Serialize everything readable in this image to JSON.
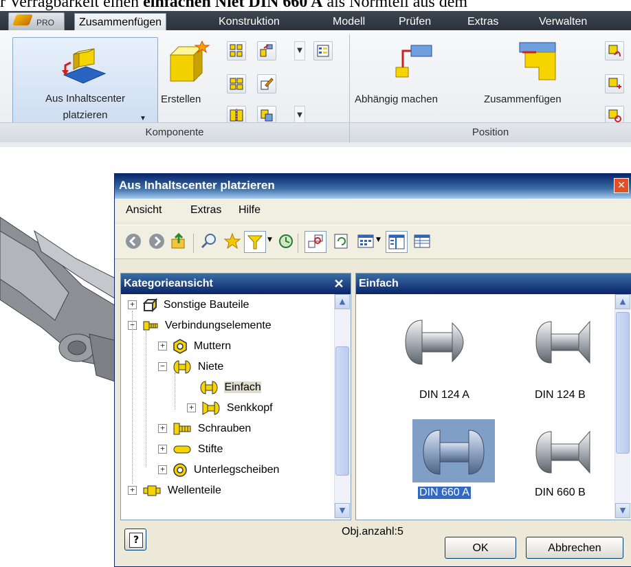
{
  "doc": {
    "text_before": "r Verragbarkeit einen ",
    "text_bold": "einfachen Niet DIN 660 A",
    "text_after": " als Normteil aus dem"
  },
  "ribbon": {
    "app_button_label": "PRO",
    "tabs": [
      "Zusammenfügen",
      "Konstruktion",
      "Modell",
      "Prüfen",
      "Extras",
      "Verwalten"
    ],
    "active_tab": "Zusammenfügen",
    "groups": {
      "komponente": {
        "label": "Komponente",
        "place_button_line1": "Aus Inhaltscenter",
        "place_button_line2": "platzieren",
        "create_button": "Erstellen"
      },
      "position": {
        "label": "Position",
        "constrain_button": "Abhängig machen",
        "assemble_button": "Zusammenfügen"
      }
    }
  },
  "dialog": {
    "title": "Aus Inhaltscenter platzieren",
    "close_glyph": "✕",
    "menu": [
      "Ansicht",
      "Extras",
      "Hilfe"
    ],
    "left_panel": {
      "title": "Kategorieansicht",
      "close_glyph": "✕",
      "tree": [
        {
          "label": "Sonstige Bauteile",
          "expander": "+"
        },
        {
          "label": "Verbindungselemente",
          "expander": "−"
        },
        {
          "label": "Muttern",
          "expander": "+"
        },
        {
          "label": "Niete",
          "expander": "−"
        },
        {
          "label": "Einfach",
          "expander": ""
        },
        {
          "label": "Senkkopf",
          "expander": "+"
        },
        {
          "label": "Schrauben",
          "expander": "+"
        },
        {
          "label": "Stifte",
          "expander": "+"
        },
        {
          "label": "Unterlegscheiben",
          "expander": "+"
        },
        {
          "label": "Wellenteile",
          "expander": "+"
        }
      ]
    },
    "right_panel": {
      "title": "Einfach",
      "items": [
        {
          "label": "DIN 124 A",
          "selected": false
        },
        {
          "label": "DIN 124 B",
          "selected": false
        },
        {
          "label": "DIN 660 A",
          "selected": true
        },
        {
          "label": "DIN 660 B",
          "selected": false
        }
      ]
    },
    "help_glyph": "?",
    "object_count": "Obj.anzahl:5",
    "ok_label": "OK",
    "cancel_label": "Abbrechen"
  },
  "colors": {
    "title_bar": "#0a246a",
    "selection": "#316ac5",
    "ribbon_dark": "#2e3741",
    "dialog_bg": "#ece9d8"
  }
}
